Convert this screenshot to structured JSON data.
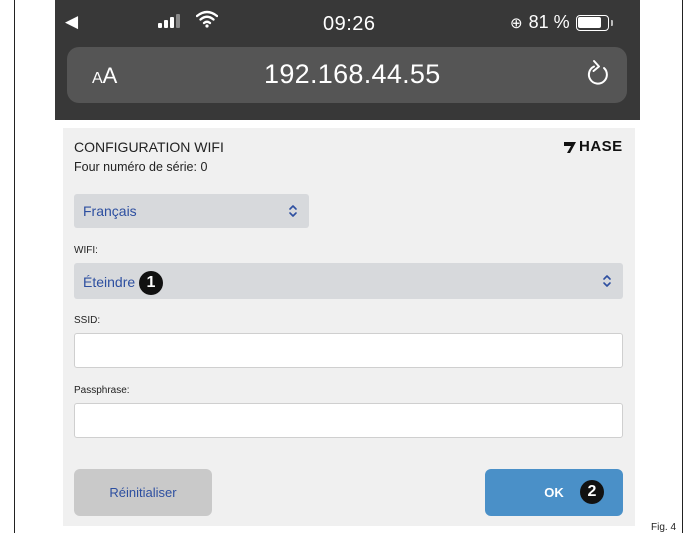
{
  "figure": {
    "label": "Fig. 4"
  },
  "status_bar": {
    "back_icon": "back-arrow-icon",
    "time": "09:26",
    "battery_percent_text": "81 %",
    "battery_level": 0.81
  },
  "url_bar": {
    "text_size_label": "AA",
    "url": "192.168.44.55",
    "reload_icon": "reload-icon"
  },
  "page": {
    "title": "CONFIGURATION WIFI",
    "serial": "Four numéro de série: 0",
    "logo_text": "HASE",
    "language_select": {
      "value": "Français"
    },
    "wifi": {
      "label": "WIFI:",
      "value": "Éteindre"
    },
    "ssid": {
      "label": "SSID:",
      "value": ""
    },
    "passphrase": {
      "label": "Passphrase:",
      "value": ""
    },
    "reset_button": "Réinitialiser",
    "ok_button": "OK"
  },
  "callouts": {
    "one": "1",
    "two": "2"
  },
  "colors": {
    "phone_chrome": "#383838",
    "url_bar": "#555555",
    "select_bg": "#d7d9dc",
    "select_text": "#2d4fa0",
    "ok_button": "#4a90c8",
    "reset_button": "#c9c9c9"
  }
}
